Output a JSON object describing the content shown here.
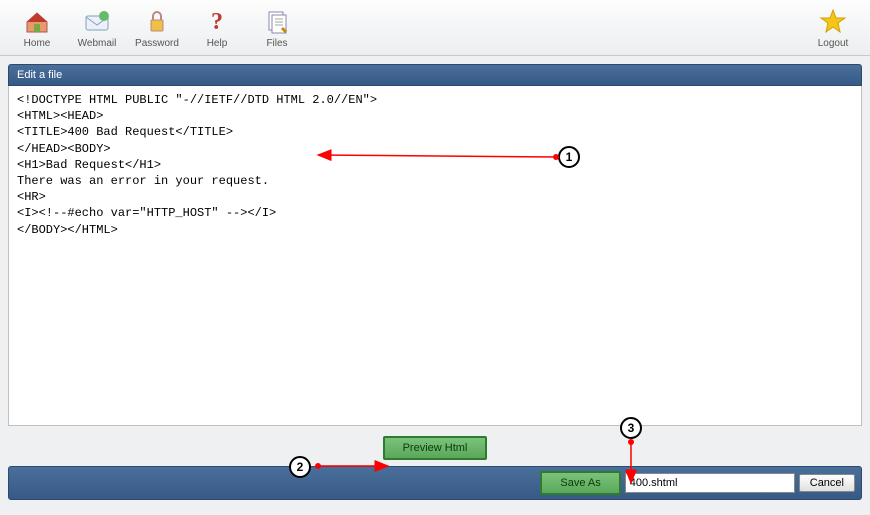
{
  "toolbar": {
    "home": "Home",
    "webmail": "Webmail",
    "password": "Password",
    "help": "Help",
    "files": "Files",
    "logout": "Logout"
  },
  "panel": {
    "title": "Edit a file"
  },
  "editor": {
    "content": "<!DOCTYPE HTML PUBLIC \"-//IETF//DTD HTML 2.0//EN\">\n<HTML><HEAD>\n<TITLE>400 Bad Request</TITLE>\n</HEAD><BODY>\n<H1>Bad Request</H1>\nThere was an error in your request.\n<HR>\n<I><!--#echo var=\"HTTP_HOST\" --></I>\n</BODY></HTML>"
  },
  "buttons": {
    "preview": "Preview Html",
    "save_as": "Save As",
    "cancel": "Cancel"
  },
  "filename": {
    "value": "400.shtml"
  },
  "annotations": {
    "one": "1",
    "two": "2",
    "three": "3"
  }
}
